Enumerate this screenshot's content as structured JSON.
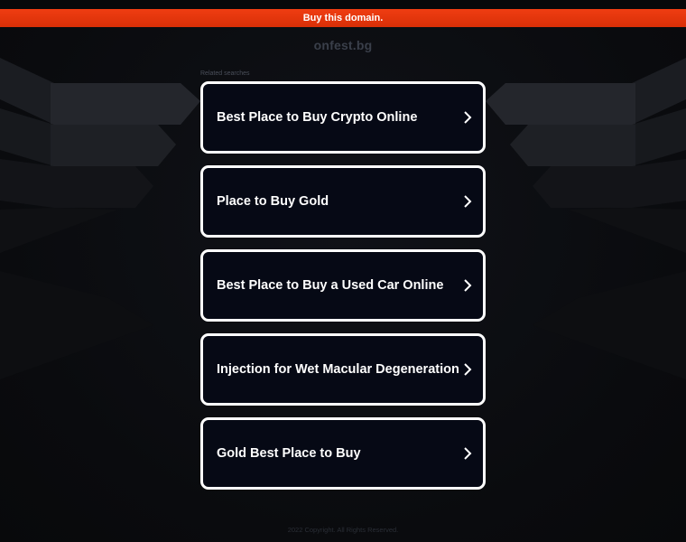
{
  "banner": {
    "label": "Buy this domain."
  },
  "domain": {
    "name": "onfest.bg"
  },
  "related": {
    "heading": "Related searches",
    "items": [
      {
        "label": "Best Place to Buy Crypto Online"
      },
      {
        "label": "Place to Buy Gold"
      },
      {
        "label": "Best Place to Buy a Used Car Online"
      },
      {
        "label": "Injection for Wet Macular Degeneration"
      },
      {
        "label": "Gold Best Place to Buy"
      }
    ]
  },
  "footer": {
    "text": "2022 Copyright. All Rights Reserved."
  },
  "colors": {
    "banner": "#e3370a",
    "background": "#0b0c10",
    "card_border": "#ffffff",
    "card_fill": "#060915"
  },
  "icons": {
    "item_arrow": "chevron-right-icon"
  }
}
